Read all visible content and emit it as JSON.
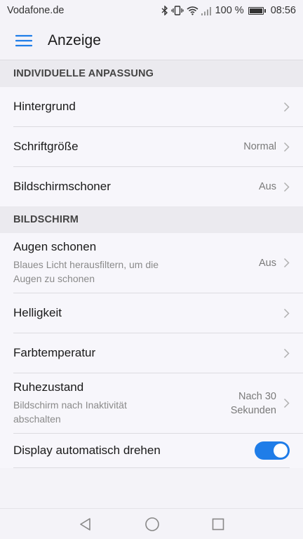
{
  "status_bar": {
    "carrier": "Vodafone.de",
    "battery_text": "100 %",
    "time": "08:56",
    "battery_level": 1.0
  },
  "app_bar": {
    "title": "Anzeige"
  },
  "sections": {
    "individual": {
      "header": "INDIVIDUELLE ANPASSUNG",
      "items": {
        "background": {
          "title": "Hintergrund"
        },
        "font_size": {
          "title": "Schriftgröße",
          "value": "Normal"
        },
        "screensaver": {
          "title": "Bildschirmschoner",
          "value": "Aus"
        }
      }
    },
    "screen": {
      "header": "BILDSCHIRM",
      "items": {
        "eye_comfort": {
          "title": "Augen schonen",
          "subtitle_line1": "Blaues Licht herausfiltern, um die",
          "subtitle_line2": "Augen zu schonen",
          "value": "Aus"
        },
        "brightness": {
          "title": "Helligkeit"
        },
        "color_temp": {
          "title": "Farbtemperatur"
        },
        "sleep": {
          "title": "Ruhezustand",
          "subtitle_line1": "Bildschirm nach Inaktivität",
          "subtitle_line2": "abschalten",
          "value_line1": "Nach 30",
          "value_line2": "Sekunden"
        },
        "auto_rotate": {
          "title": "Display automatisch drehen",
          "enabled": true
        }
      }
    }
  },
  "colors": {
    "accent": "#1f7de8",
    "background": "#f4f3f8"
  }
}
